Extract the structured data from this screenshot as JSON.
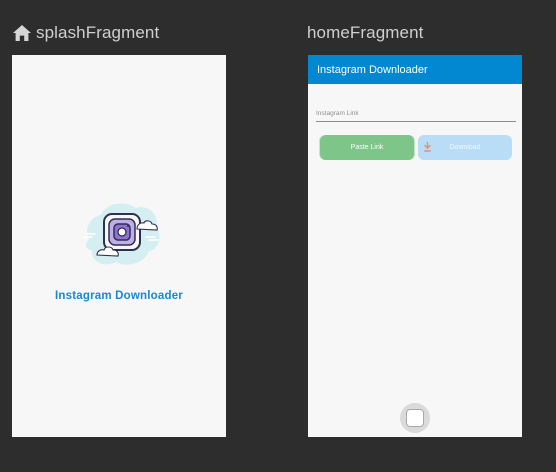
{
  "fragments": {
    "splash": {
      "title": "splashFragment",
      "app_name": "Instagram Downloader"
    },
    "home": {
      "title": "homeFragment",
      "toolbar_title": "Instagram Downloader",
      "link_input": {
        "placeholder": "Instagram Link",
        "value": ""
      },
      "paste_button_label": "Paste Link",
      "download_button_label": "Download"
    }
  },
  "colors": {
    "canvas_background": "#2d2d2d",
    "screen_background": "#f7f7f7",
    "appbar": "#0288d1",
    "accent_text": "#1a88d0",
    "paste_button": "#7ec58a",
    "download_button": "#b9dcf7",
    "download_icon": "#f08a6b"
  },
  "icons": {
    "fragment_start": "home-icon",
    "splash_art": "instagram-illustration",
    "download": "download-icon",
    "system_home": "home-button-icon"
  }
}
